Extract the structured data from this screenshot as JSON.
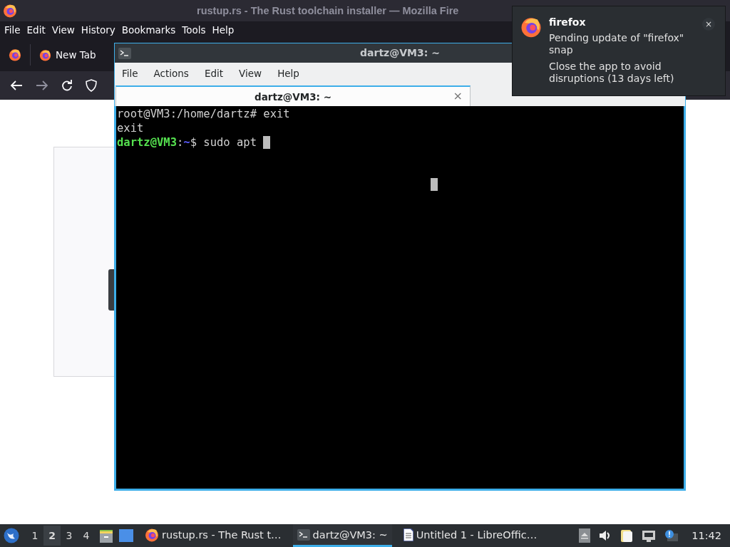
{
  "browser": {
    "title": "rustup.rs - The Rust toolchain installer — Mozilla Fire",
    "menu": [
      "File",
      "Edit",
      "View",
      "History",
      "Bookmarks",
      "Tools",
      "Help"
    ],
    "tab": {
      "label": "New Tab"
    }
  },
  "terminal": {
    "title": "dartz@VM3: ~",
    "menu": [
      "File",
      "Actions",
      "Edit",
      "View",
      "Help"
    ],
    "tabs": [
      {
        "label": "dartz@VM3: ~",
        "close": "×",
        "selected": true
      }
    ],
    "lines": [
      {
        "cursor": false,
        "segments": [
          {
            "kind": "plain",
            "text": "root@VM3:/home/dartz# exit"
          }
        ]
      },
      {
        "cursor": false,
        "segments": [
          {
            "kind": "plain",
            "text": "exit"
          }
        ]
      },
      {
        "cursor": true,
        "segments": [
          {
            "kind": "user",
            "text": "dartz@VM3"
          },
          {
            "kind": "plain",
            "text": ":"
          },
          {
            "kind": "path",
            "text": "~"
          },
          {
            "kind": "plain",
            "text": "$ sudo apt "
          }
        ]
      }
    ]
  },
  "notification": {
    "app": "firefox",
    "message": "Pending update of \"firefox\" snap",
    "detail": "Close the app to avoid disruptions (13 days left)",
    "close": "×"
  },
  "taskbar": {
    "workspaces": [
      {
        "label": "1",
        "selected": false
      },
      {
        "label": "2",
        "selected": true
      },
      {
        "label": "3",
        "selected": false
      },
      {
        "label": "4",
        "selected": false
      }
    ],
    "tasks": [
      {
        "kind": "firefox",
        "label": "rustup.rs - The Rust t…",
        "selected": false
      },
      {
        "kind": "terminal",
        "label": "dartz@VM3: ~",
        "selected": true
      },
      {
        "kind": "document",
        "label": "Untitled 1 - LibreOffic…",
        "selected": false
      }
    ],
    "clock": "11:42"
  }
}
